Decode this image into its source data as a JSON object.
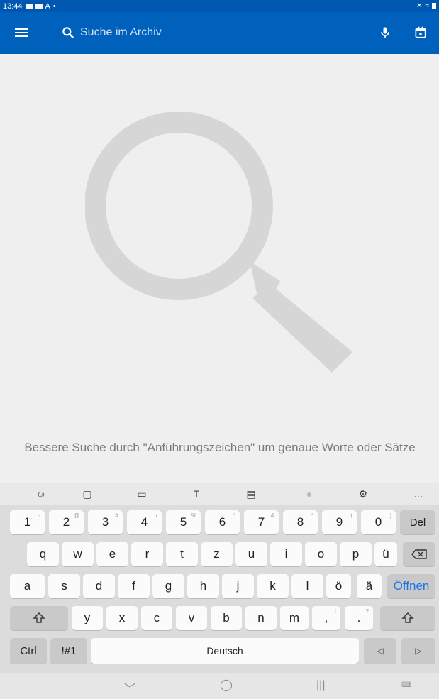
{
  "status_bar": {
    "time": "13:44",
    "letter": "A",
    "dot": "•"
  },
  "app_bar": {
    "search_placeholder": "Suche im Archiv"
  },
  "main": {
    "hint": "Bessere Suche durch \"Anführungszeichen\" um genaue Worte oder Sätze"
  },
  "keyboard": {
    "toolbar_icons": [
      "emoji-icon",
      "sticker-icon",
      "gif-icon",
      "handwriting-icon",
      "clipboard-icon",
      "voice-icon",
      "settings-icon",
      "more-icon"
    ],
    "number_row": [
      {
        "label": "1",
        "sup": "-"
      },
      {
        "label": "2",
        "sup": "@"
      },
      {
        "label": "3",
        "sup": "#"
      },
      {
        "label": "4",
        "sup": "/"
      },
      {
        "label": "5",
        "sup": "%"
      },
      {
        "label": "6",
        "sup": "*"
      },
      {
        "label": "7",
        "sup": "&"
      },
      {
        "label": "8",
        "sup": "*"
      },
      {
        "label": "9",
        "sup": "("
      },
      {
        "label": "0",
        "sup": ")"
      }
    ],
    "del_label": "Del",
    "row_q": [
      "q",
      "w",
      "e",
      "r",
      "t",
      "z",
      "u",
      "i",
      "o",
      "p",
      "ü"
    ],
    "row_a": [
      "a",
      "s",
      "d",
      "f",
      "g",
      "h",
      "j",
      "k",
      "l",
      "ö",
      "ä"
    ],
    "open_label": "Öffnen",
    "row_y": [
      "y",
      "x",
      "c",
      "v",
      "b",
      "n",
      "m"
    ],
    "comma_label": ",",
    "comma_sup": "!",
    "period_label": ".",
    "period_sup": "?",
    "ctrl_label": "Ctrl",
    "sym_label": "!#1",
    "space_label": "Deutsch"
  },
  "colors": {
    "app_bar": "#0061bd",
    "status_bar": "#0057b0",
    "accent_text": "#1a73e8"
  }
}
